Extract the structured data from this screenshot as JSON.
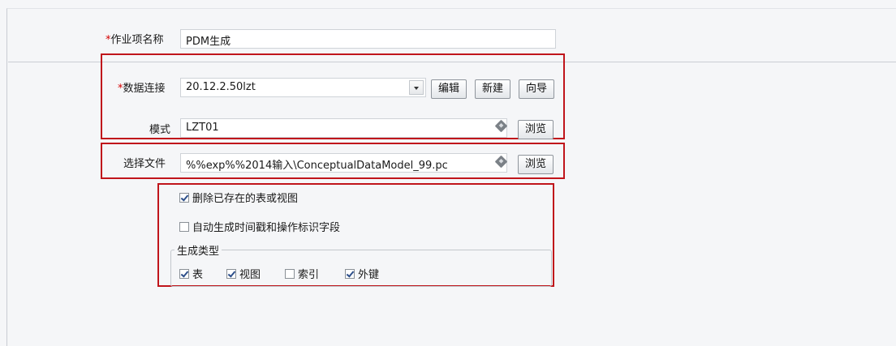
{
  "form": {
    "job_name": {
      "required_mark": "*",
      "label": "作业项名称",
      "value": "PDM生成"
    },
    "connection": {
      "required_mark": "*",
      "label": "数据连接",
      "value": "20.12.2.50lzt",
      "edit_label": "编辑",
      "new_label": "新建",
      "wizard_label": "向导"
    },
    "schema": {
      "label": "模式",
      "value": "LZT01",
      "browse_label": "浏览"
    },
    "file": {
      "label": "选择文件",
      "value": "%%exp%%2014输入\\ConceptualDataModel_99.pc",
      "browse_label": "浏览"
    },
    "options": {
      "drop_existing": {
        "label": "删除已存在的表或视图",
        "checked": true
      },
      "auto_timestamp": {
        "label": "自动生成时间戳和操作标识字段",
        "checked": false
      }
    },
    "gen_type": {
      "title": "生成类型",
      "items": [
        {
          "label": "表",
          "checked": true
        },
        {
          "label": "视图",
          "checked": true
        },
        {
          "label": "索引",
          "checked": false
        },
        {
          "label": "外键",
          "checked": true
        }
      ]
    }
  },
  "colors": {
    "highlight_border": "#c0151b",
    "required": "#d40000"
  }
}
